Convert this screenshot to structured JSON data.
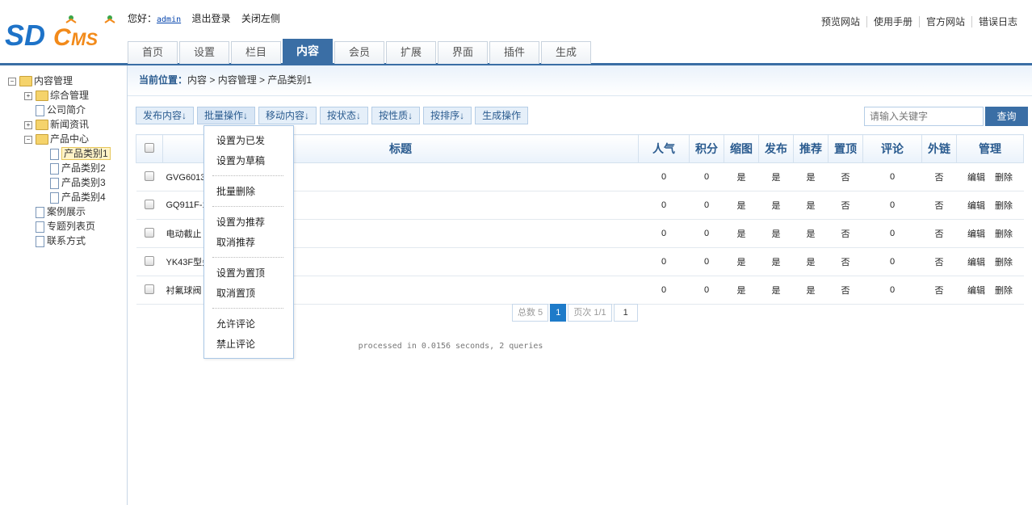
{
  "header": {
    "logo_text": "SDCMS",
    "greeting": "您好：",
    "user": "admin",
    "logout": "退出登录",
    "close_left": "关闭左侧",
    "top_links": [
      "预览网站",
      "使用手册",
      "官方网站",
      "错误日志"
    ],
    "tabs": [
      "首页",
      "设置",
      "栏目",
      "内容",
      "会员",
      "扩展",
      "界面",
      "插件",
      "生成"
    ],
    "active_tab": "内容"
  },
  "sidebar": {
    "root": "内容管理",
    "items": [
      {
        "label": "综合管理"
      },
      {
        "label": "公司简介"
      },
      {
        "label": "新闻资讯"
      },
      {
        "label": "产品中心"
      },
      {
        "label": "产品类别1"
      },
      {
        "label": "产品类别2"
      },
      {
        "label": "产品类别3"
      },
      {
        "label": "产品类别4"
      },
      {
        "label": "案例展示"
      },
      {
        "label": "专题列表页"
      },
      {
        "label": "联系方式"
      }
    ]
  },
  "breadcrumb": {
    "label": "当前位置：",
    "path": "内容 > 内容管理 > 产品类别1"
  },
  "toolbar": [
    "发布内容↓",
    "批量操作↓",
    "移动内容↓",
    "按状态↓",
    "按性质↓",
    "按排序↓",
    "生成操作"
  ],
  "search": {
    "placeholder": "请输入关键字",
    "button": "查询"
  },
  "table": {
    "headers": [
      "标题",
      "人气",
      "积分",
      "缩图",
      "发布",
      "推荐",
      "置顶",
      "评论",
      "外链",
      "管理"
    ],
    "rows": [
      {
        "title": "GVG6013中",
        "views": "0",
        "points": "0",
        "thumb": "是",
        "published": "是",
        "recommended": "是",
        "top": "否",
        "comments": "0",
        "link": "否"
      },
      {
        "title": "GQ911F-1",
        "views": "0",
        "points": "0",
        "thumb": "是",
        "published": "是",
        "recommended": "是",
        "top": "否",
        "comments": "0",
        "link": "否"
      },
      {
        "title": "电动截止",
        "views": "0",
        "points": "0",
        "thumb": "是",
        "published": "是",
        "recommended": "是",
        "top": "否",
        "comments": "0",
        "link": "否"
      },
      {
        "title": "YK43F型先",
        "views": "0",
        "points": "0",
        "thumb": "是",
        "published": "是",
        "recommended": "是",
        "top": "否",
        "comments": "0",
        "link": "否"
      },
      {
        "title": "衬氟球阀",
        "views": "0",
        "points": "0",
        "thumb": "是",
        "published": "是",
        "recommended": "是",
        "top": "否",
        "comments": "0",
        "link": "否"
      }
    ],
    "edit": "编辑",
    "delete": "删除"
  },
  "pager": {
    "total": "总数 5",
    "current": "1",
    "pages": "页次 1/1",
    "jump": "1"
  },
  "footer": "processed in 0.0156 seconds, 2 queries",
  "dropdown": {
    "items": [
      "设置为已发",
      "设置为草稿",
      "批量删除",
      "设置为推荐",
      "取消推荐",
      "设置为置顶",
      "取消置顶",
      "允许评论",
      "禁止评论"
    ]
  }
}
